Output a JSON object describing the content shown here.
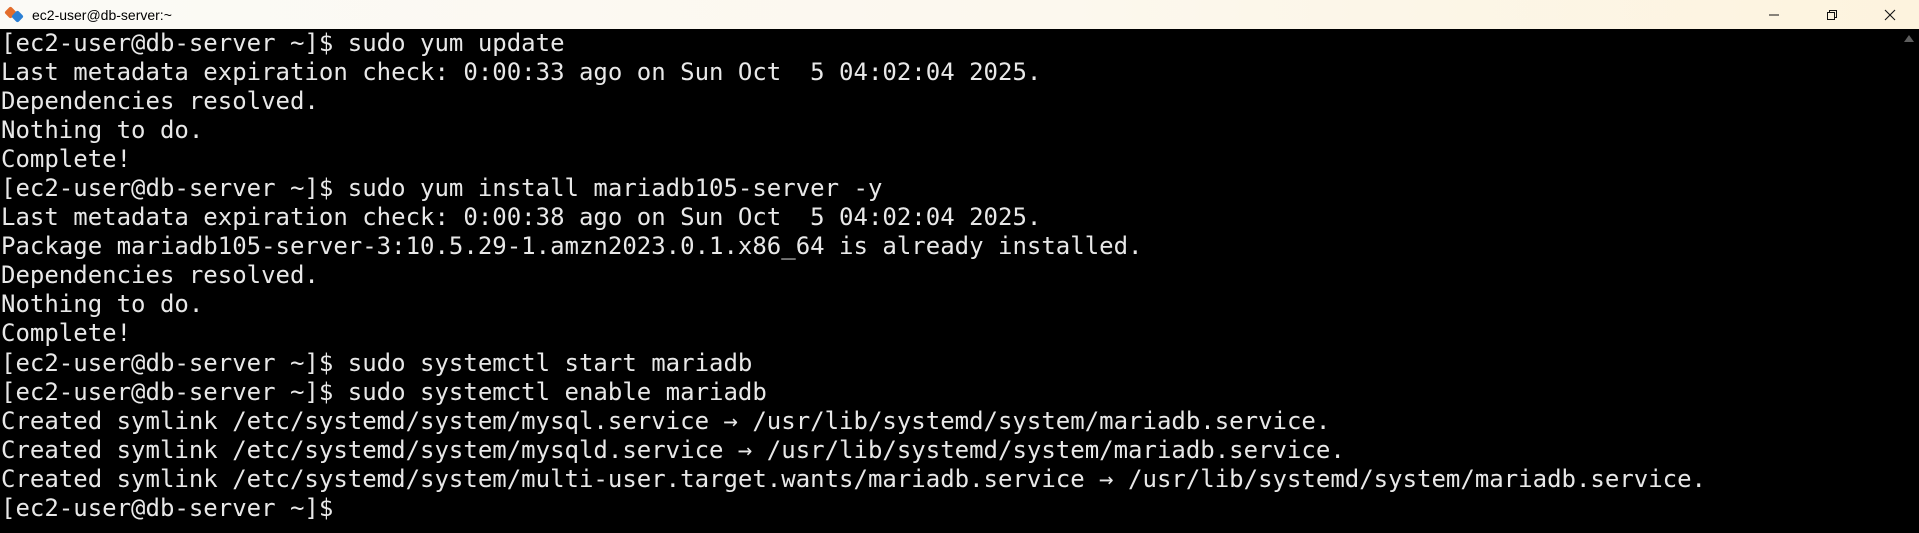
{
  "window": {
    "title": "ec2-user@db-server:~",
    "icon": "putty-icon",
    "controls": [
      "minimize-icon",
      "restore-icon",
      "close-icon"
    ]
  },
  "colors": {
    "background": "#000000",
    "foreground": "#e8e8e8",
    "titlebar": "#fcf8ee"
  },
  "terminal": {
    "lines": [
      "[ec2-user@db-server ~]$ sudo yum update",
      "Last metadata expiration check: 0:00:33 ago on Sun Oct  5 04:02:04 2025.",
      "Dependencies resolved.",
      "Nothing to do.",
      "Complete!",
      "[ec2-user@db-server ~]$ sudo yum install mariadb105-server -y",
      "Last metadata expiration check: 0:00:38 ago on Sun Oct  5 04:02:04 2025.",
      "Package mariadb105-server-3:10.5.29-1.amzn2023.0.1.x86_64 is already installed.",
      "Dependencies resolved.",
      "Nothing to do.",
      "Complete!",
      "[ec2-user@db-server ~]$ sudo systemctl start mariadb",
      "[ec2-user@db-server ~]$ sudo systemctl enable mariadb",
      "Created symlink /etc/systemd/system/mysql.service → /usr/lib/systemd/system/mariadb.service.",
      "Created symlink /etc/systemd/system/mysqld.service → /usr/lib/systemd/system/mariadb.service.",
      "Created symlink /etc/systemd/system/multi-user.target.wants/mariadb.service → /usr/lib/systemd/system/mariadb.service.",
      "[ec2-user@db-server ~]$ "
    ]
  }
}
